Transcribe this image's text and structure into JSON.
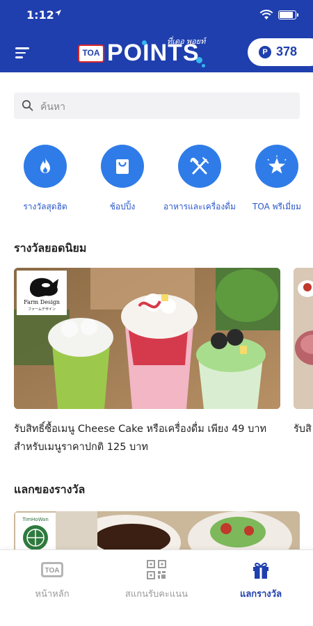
{
  "status_bar": {
    "time": "1:12"
  },
  "header": {
    "logo_badge": "TOA",
    "logo_word": "POINTS",
    "logo_tagline": "ที่เดอ พอยท์",
    "points": "378",
    "points_coin": "P"
  },
  "search": {
    "placeholder": "ค้นหา"
  },
  "categories": [
    {
      "label": "รางวัลสุดฮิต",
      "icon": "flame-icon"
    },
    {
      "label": "ช้อปปิ้ง",
      "icon": "shopping-bag-icon"
    },
    {
      "label": "อาหารและเครื่องดื่ม",
      "icon": "fork-knife-icon"
    },
    {
      "label": "TOA พรีเมี่ยม",
      "icon": "star-burst-icon"
    }
  ],
  "sections": {
    "popular_title": "รางวัลยอดนิยม",
    "redeem_title": "แลกของรางวัล"
  },
  "popular_cards": [
    {
      "brand": "Farm Design",
      "brand_sub": "ファームデザイン",
      "description": "รับสิทธิ์ซื้อเมนู Cheese Cake หรือเครื่องดื่ม เพียง 49 บาท สำหรับเมนูราคาปกติ 125 บาท"
    },
    {
      "description": "รับสิ"
    }
  ],
  "redeem_cards": [
    {
      "brand": "TimHoWan"
    }
  ],
  "tabbar": [
    {
      "label": "หน้าหลัก",
      "icon": "toa-home-icon",
      "active": false
    },
    {
      "label": "สแกนรับคะแนน",
      "icon": "qr-code-icon",
      "active": false
    },
    {
      "label": "แลกรางวัล",
      "icon": "gift-icon",
      "active": true
    }
  ],
  "colors": {
    "header_blue": "#1f3fae",
    "category_blue": "#2f7ce8",
    "label_blue": "#2a57c9"
  }
}
